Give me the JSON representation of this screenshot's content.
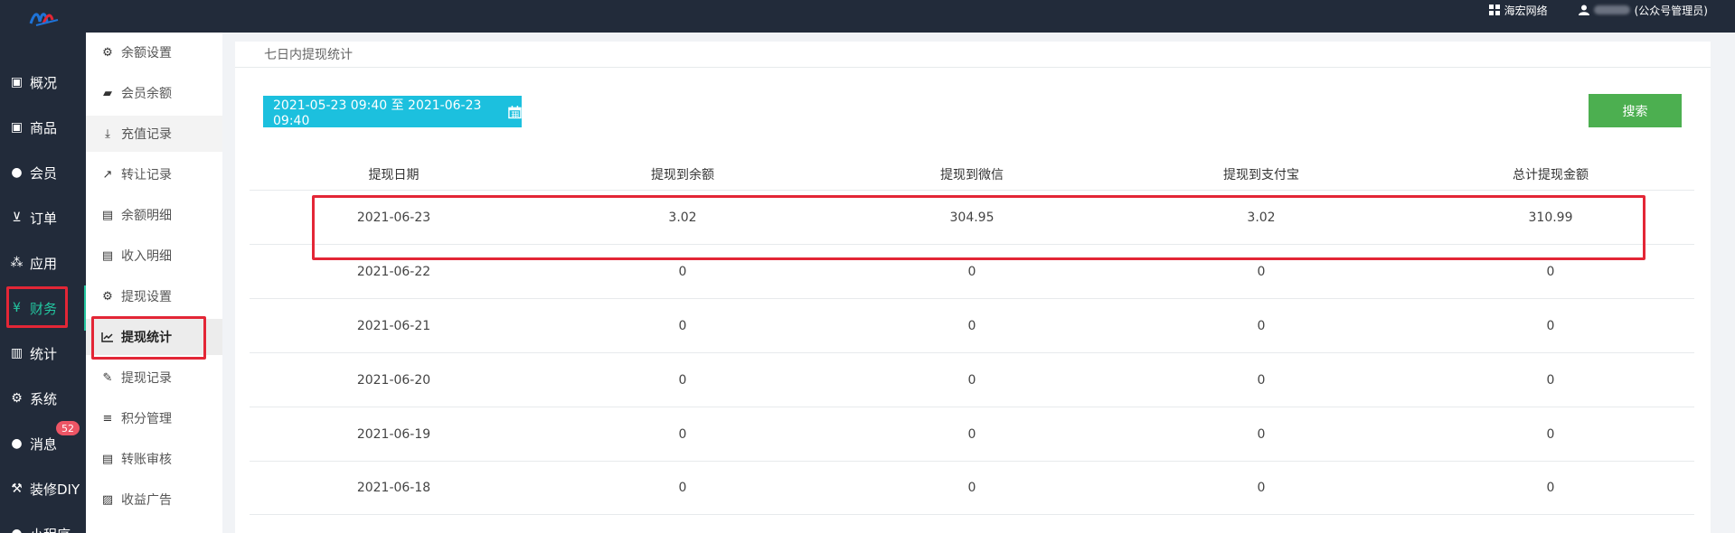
{
  "topbar": {
    "logo_icon": "brand-logo",
    "company_icon": "grid-icon",
    "company_label": "海宏网络",
    "user_icon": "user-icon",
    "user_role": "(公众号管理员)"
  },
  "sidebar": {
    "active_color": "#23c6a0",
    "items": [
      {
        "icon": "archive-icon",
        "label": "概况"
      },
      {
        "icon": "archive-icon",
        "label": "商品"
      },
      {
        "icon": "users-icon",
        "label": "会员"
      },
      {
        "icon": "cart-icon",
        "label": "订单"
      },
      {
        "icon": "cubes-icon",
        "label": "应用"
      },
      {
        "icon": "yen-icon",
        "label": "财务"
      },
      {
        "icon": "bar-chart-icon",
        "label": "统计"
      },
      {
        "icon": "cogs-icon",
        "label": "系统"
      },
      {
        "icon": "comment-icon",
        "label": "消息",
        "badge": "52"
      },
      {
        "icon": "gavel-icon",
        "label": "装修DIY"
      },
      {
        "icon": "app-icon",
        "label": "小程序"
      }
    ]
  },
  "subnav": {
    "items": [
      {
        "icon": "gear-icon",
        "label": "余额设置"
      },
      {
        "icon": "book-icon",
        "label": "会员余额"
      },
      {
        "icon": "download-icon",
        "label": "充值记录"
      },
      {
        "icon": "external-link-icon",
        "label": "转让记录"
      },
      {
        "icon": "file-icon",
        "label": "余额明细"
      },
      {
        "icon": "file-icon",
        "label": "收入明细"
      },
      {
        "icon": "gear-icon",
        "label": "提现设置"
      },
      {
        "icon": "line-chart-icon",
        "label": "提现统计"
      },
      {
        "icon": "pencil-icon",
        "label": "提现记录"
      },
      {
        "icon": "database-icon",
        "label": "积分管理"
      },
      {
        "icon": "file-icon",
        "label": "转账审核"
      },
      {
        "icon": "image-icon",
        "label": "收益广告"
      }
    ]
  },
  "main": {
    "title": "七日内提现统计",
    "date_range": "2021-05-23 09:40 至 2021-06-23 09:40",
    "calendar_icon": "calendar-icon",
    "search_label": "搜索",
    "accent_color": "#1cc0de",
    "search_color": "#4caf50",
    "table": {
      "columns": [
        "提现日期",
        "提现到余额",
        "提现到微信",
        "提现到支付宝",
        "总计提现金额"
      ],
      "rows": [
        [
          "2021-06-23",
          "3.02",
          "304.95",
          "3.02",
          "310.99"
        ],
        [
          "2021-06-22",
          "0",
          "0",
          "0",
          "0"
        ],
        [
          "2021-06-21",
          "0",
          "0",
          "0",
          "0"
        ],
        [
          "2021-06-20",
          "0",
          "0",
          "0",
          "0"
        ],
        [
          "2021-06-19",
          "0",
          "0",
          "0",
          "0"
        ],
        [
          "2021-06-18",
          "0",
          "0",
          "0",
          "0"
        ]
      ]
    }
  }
}
